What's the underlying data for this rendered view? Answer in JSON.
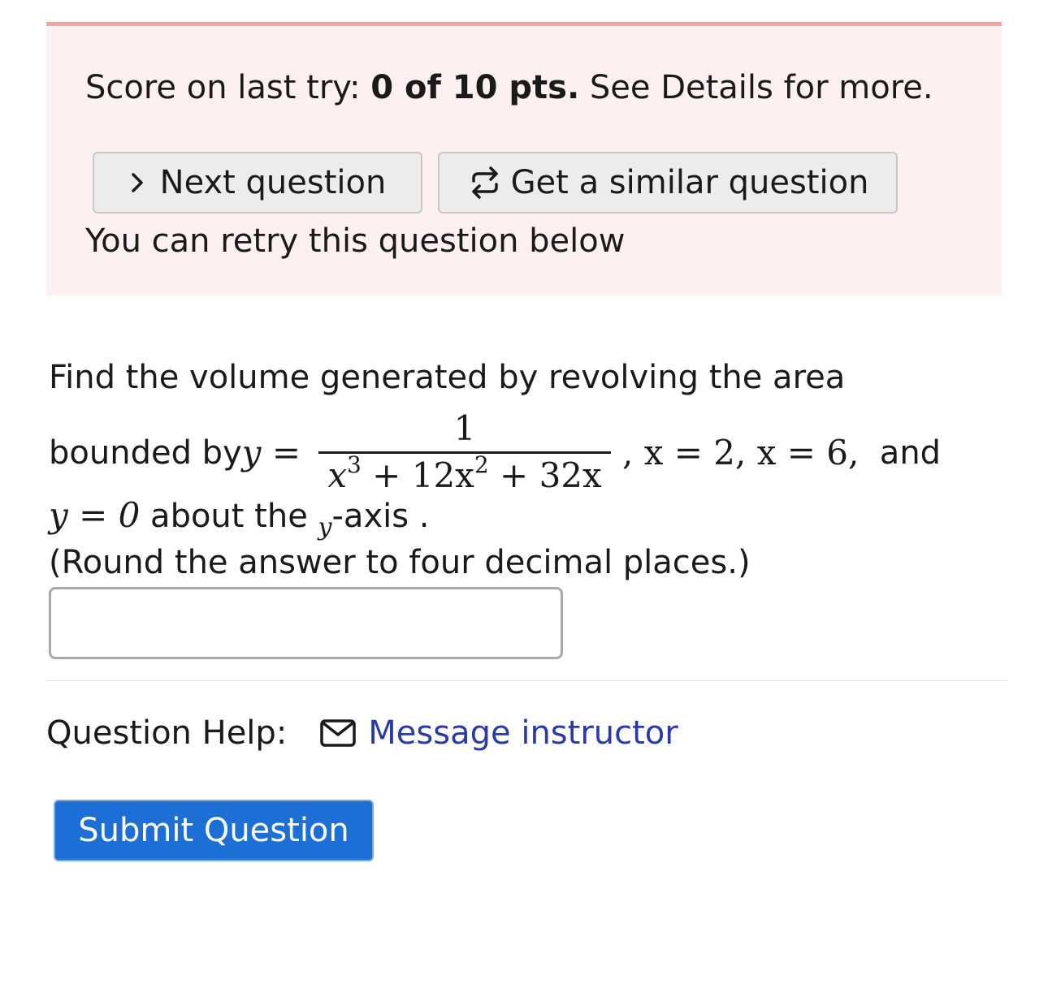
{
  "score": {
    "prefix": "Score on last try: ",
    "value": "0 of 10 pts.",
    "suffix": " See Details for more."
  },
  "buttons": {
    "next_label": "Next question",
    "similar_label": "Get a similar question"
  },
  "retry_text": "You can retry this question below",
  "question": {
    "line1": "Find the volume generated by revolving the area",
    "bounded_by": "bounded by ",
    "y_eq": "y =",
    "numerator": "1",
    "den_x3": "x",
    "den_exp3": "3",
    "den_mid": " + 12x",
    "den_exp2": "2",
    "den_tail": " + 32x",
    "after_frac": ", x = 2, x = 6,",
    "and": "  and",
    "line3_math": "y = 0",
    "line3_text1": " about the ",
    "line3_axis_var": "y",
    "line3_text2": "-axis .",
    "line4": "(Round the answer to four decimal places.)"
  },
  "answer": {
    "value": "",
    "placeholder": ""
  },
  "help": {
    "label": "Question Help:",
    "link_label": "Message instructor"
  },
  "submit_label": "Submit Question",
  "colors": {
    "score_bg": "#fdf0f0",
    "score_border": "#f5a3a3",
    "link": "#2b3aa8",
    "submit_bg": "#1d6fd6"
  },
  "icons": {
    "next": "chevron-right-icon",
    "similar": "repeat-arrows-icon",
    "message": "envelope-icon"
  }
}
